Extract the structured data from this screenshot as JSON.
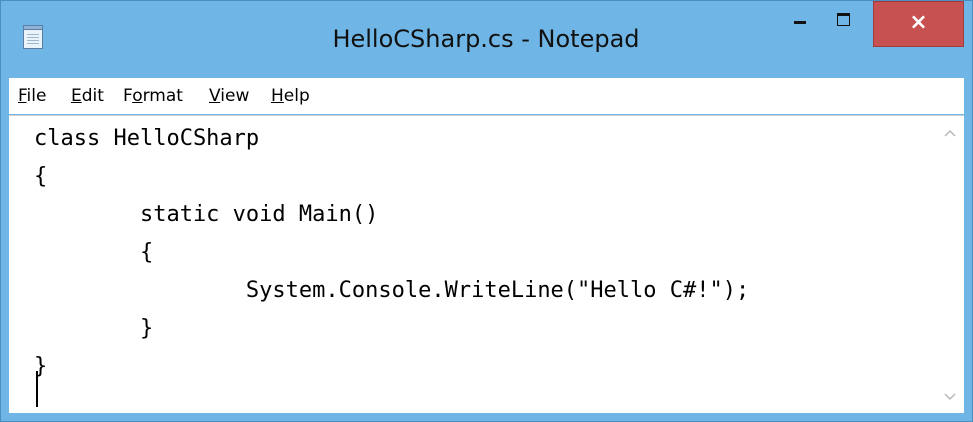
{
  "window": {
    "title": "HelloCSharp.cs - Notepad",
    "close_glyph": "×"
  },
  "menu": {
    "items": [
      {
        "label": "File",
        "mnemonic": "F",
        "rest": "ile"
      },
      {
        "label": "Edit",
        "mnemonic": "E",
        "rest": "dit"
      },
      {
        "label": "Format",
        "pre": "F",
        "mnemonic": "o",
        "rest": "rmat"
      },
      {
        "label": "View",
        "mnemonic": "V",
        "rest": "iew"
      },
      {
        "label": "Help",
        "mnemonic": "H",
        "rest": "elp"
      }
    ]
  },
  "editor": {
    "text": "class HelloCSharp\n{\n        static void Main()\n        {\n                System.Console.WriteLine(\"Hello C#!\");\n        }\n}\n"
  },
  "icons": {
    "app": "notepad-icon",
    "minimize": "minimize-icon",
    "maximize": "maximize-icon",
    "close": "close-icon",
    "scroll_up": "scroll-up-arrow-icon",
    "scroll_down": "scroll-down-arrow-icon"
  },
  "colors": {
    "titlebar": "#6fb6e6",
    "close_button": "#c75050"
  }
}
